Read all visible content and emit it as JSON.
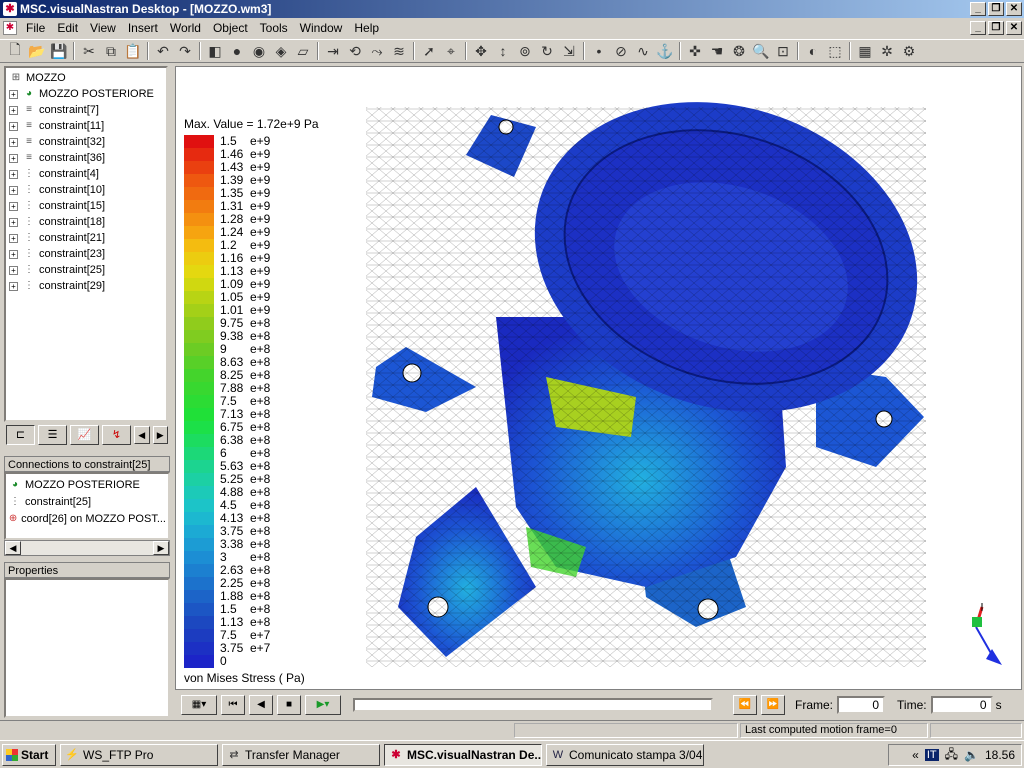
{
  "window": {
    "title": "MSC.visualNastran Desktop - [MOZZO.wm3]"
  },
  "menu": [
    "File",
    "Edit",
    "View",
    "Insert",
    "World",
    "Object",
    "Tools",
    "Window",
    "Help"
  ],
  "tree": {
    "root": "MOZZO",
    "items": [
      "MOZZO POSTERIORE",
      "constraint[7]",
      "constraint[11]",
      "constraint[32]",
      "constraint[36]",
      "constraint[4]",
      "constraint[10]",
      "constraint[15]",
      "constraint[18]",
      "constraint[21]",
      "constraint[23]",
      "constraint[25]",
      "constraint[29]"
    ]
  },
  "connections": {
    "header": "Connections to constraint[25]",
    "items": [
      "MOZZO POSTERIORE",
      "constraint[25]",
      "coord[26] on MOZZO POST..."
    ]
  },
  "properties": {
    "header": "Properties"
  },
  "legend": {
    "max_label": "Max. Value = 1.72e+9 Pa",
    "footer": "von Mises  Stress  ( Pa)",
    "entries": [
      [
        "1.5",
        "e+9",
        "#e01010"
      ],
      [
        "1.46",
        "e+9",
        "#e62a10"
      ],
      [
        "1.43",
        "e+9",
        "#ea4010"
      ],
      [
        "1.39",
        "e+9",
        "#ee5810"
      ],
      [
        "1.35",
        "e+9",
        "#f06a10"
      ],
      [
        "1.31",
        "e+9",
        "#f27c10"
      ],
      [
        "1.28",
        "e+9",
        "#f49010"
      ],
      [
        "1.24",
        "e+9",
        "#f6a410"
      ],
      [
        "1.2",
        "e+9",
        "#f4bc10"
      ],
      [
        "1.16",
        "e+9",
        "#eccc10"
      ],
      [
        "1.13",
        "e+9",
        "#e4d810"
      ],
      [
        "1.09",
        "e+9",
        "#d0d810"
      ],
      [
        "1.05",
        "e+9",
        "#b8d414"
      ],
      [
        "1.01",
        "e+9",
        "#a4d018"
      ],
      [
        "9.75",
        "e+8",
        "#90cc1c"
      ],
      [
        "9.38",
        "e+8",
        "#80cc20"
      ],
      [
        "9",
        "e+8",
        "#6ccc24"
      ],
      [
        "8.63",
        "e+8",
        "#58d028"
      ],
      [
        "8.25",
        "e+8",
        "#44d42c"
      ],
      [
        "7.88",
        "e+8",
        "#38d830"
      ],
      [
        "7.5",
        "e+8",
        "#2cdc34"
      ],
      [
        "7.13",
        "e+8",
        "#20e038"
      ],
      [
        "6.75",
        "e+8",
        "#1ce048"
      ],
      [
        "6.38",
        "e+8",
        "#1cdc60"
      ],
      [
        "6",
        "e+8",
        "#1cd878"
      ],
      [
        "5.63",
        "e+8",
        "#1cd490"
      ],
      [
        "5.25",
        "e+8",
        "#1cd0a4"
      ],
      [
        "4.88",
        "e+8",
        "#1ccab8"
      ],
      [
        "4.5",
        "e+8",
        "#1cc4c8"
      ],
      [
        "4.13",
        "e+8",
        "#1cb8d0"
      ],
      [
        "3.75",
        "e+8",
        "#1caad4"
      ],
      [
        "3.38",
        "e+8",
        "#1c9cd4"
      ],
      [
        "3",
        "e+8",
        "#1c8ed4"
      ],
      [
        "2.63",
        "e+8",
        "#1c80d0"
      ],
      [
        "2.25",
        "e+8",
        "#1c72cc"
      ],
      [
        "1.88",
        "e+8",
        "#1c64c8"
      ],
      [
        "1.5",
        "e+8",
        "#1c56c4"
      ],
      [
        "1.13",
        "e+8",
        "#1c48c0"
      ],
      [
        "7.5",
        "e+7",
        "#1c3cc0"
      ],
      [
        "3.75",
        "e+7",
        "#1c30c4"
      ],
      [
        "0",
        "",
        "#1c24c8"
      ]
    ]
  },
  "controls": {
    "frame_label": "Frame:",
    "frame_value": "0",
    "time_label": "Time:",
    "time_value": "0",
    "time_unit": "s"
  },
  "status": {
    "message": "Last computed motion frame=0"
  },
  "taskbar": {
    "start": "Start",
    "tasks": [
      "WS_FTP Pro",
      "Transfer Manager",
      "MSC.visualNastran De...",
      "Comunicato stampa 3/04..."
    ],
    "lang": "IT",
    "arrows": "«",
    "clock": "18.56"
  }
}
